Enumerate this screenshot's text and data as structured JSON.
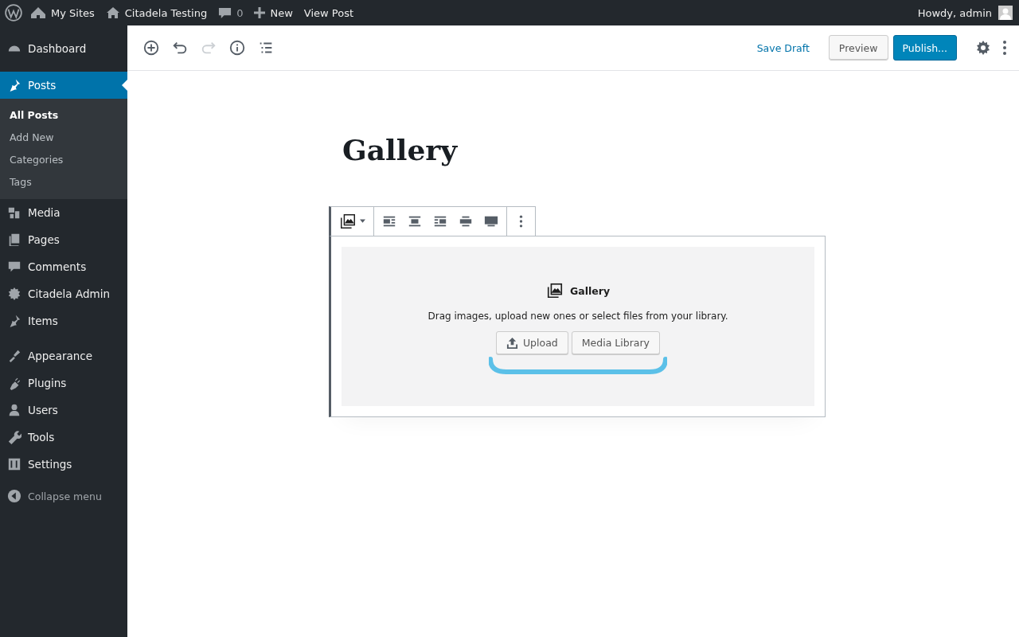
{
  "admin_bar": {
    "items": [
      {
        "kind": "logo"
      },
      {
        "kind": "sites",
        "label": "My Sites"
      },
      {
        "kind": "home",
        "label": "Citadela Testing"
      },
      {
        "kind": "comments",
        "label": "0"
      },
      {
        "kind": "new",
        "label": "New"
      },
      {
        "kind": "text",
        "label": "View Post"
      }
    ],
    "greeting": "Howdy, admin"
  },
  "sidebar": {
    "groups": [
      [
        {
          "label": "Dashboard",
          "selected": false
        }
      ],
      [
        {
          "label": "Posts",
          "selected": true,
          "children": [
            {
              "label": "All Posts",
              "selected": true
            },
            {
              "label": "Add New",
              "selected": false
            },
            {
              "label": "Categories",
              "selected": false
            },
            {
              "label": "Tags",
              "selected": false
            }
          ]
        },
        {
          "label": "Media",
          "selected": false
        },
        {
          "label": "Pages",
          "selected": false
        },
        {
          "label": "Comments",
          "selected": false
        },
        {
          "label": "Citadela Admin",
          "selected": false
        },
        {
          "label": "Items",
          "selected": false
        }
      ],
      [
        {
          "label": "Appearance",
          "selected": false
        },
        {
          "label": "Plugins",
          "selected": false
        },
        {
          "label": "Users",
          "selected": false
        },
        {
          "label": "Tools",
          "selected": false
        },
        {
          "label": "Settings",
          "selected": false
        }
      ]
    ],
    "collapse": "Collapse menu"
  },
  "editor_toolbar": {
    "tools": [
      {
        "kind": "add",
        "disabled": false
      },
      {
        "kind": "undo",
        "disabled": false
      },
      {
        "kind": "redo",
        "disabled": true
      },
      {
        "kind": "info",
        "disabled": false
      },
      {
        "kind": "outline",
        "disabled": false
      }
    ],
    "save_draft": "Save Draft",
    "preview": "Preview",
    "publish": "Publish..."
  },
  "post": {
    "title": "Gallery"
  },
  "block": {
    "title": "Gallery",
    "instructions": "Drag images, upload new ones or select files from your library.",
    "upload": "Upload",
    "media_library": "Media Library"
  }
}
